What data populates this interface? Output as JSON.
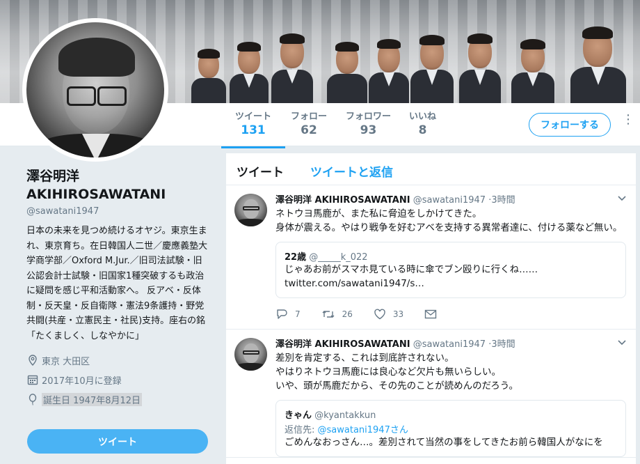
{
  "nav": {
    "stats": [
      {
        "label": "ツイート",
        "value": "131"
      },
      {
        "label": "フォロー",
        "value": "62"
      },
      {
        "label": "フォロワー",
        "value": "93"
      },
      {
        "label": "いいね",
        "value": "8"
      }
    ],
    "follow_label": "フォローする",
    "more": "⋮"
  },
  "profile": {
    "name_line1": "澤谷明洋",
    "name_line2": "AKIHIROSAWATANI",
    "handle": "@sawatani1947",
    "bio": "日本の未来を見つめ続けるオヤジ。東京生まれ、東京育ち。在日韓国人二世／慶應義塾大学商学部／Oxford M.Jur.／旧司法試験・旧公認会計士試験・旧国家1種突破するも政治に疑問を感じ平和活動家へ。 反アベ・反体制・反天皇・反自衛隊・憲法9条護持・野党共闘(共産・立憲民主・社民)支持。座右の銘「たくましく、しなやかに」",
    "location": "東京 大田区",
    "joined": "2017年10月に登録",
    "birthday": "誕生日 1947年8月12日",
    "tweet_button": "ツイート"
  },
  "timeline": {
    "tabs": [
      "ツイート",
      "ツイートと返信"
    ],
    "tweets": [
      {
        "name": "澤谷明洋 AKIHIROSAWATANI",
        "handle": "@sawatani1947",
        "time": "·3時間",
        "lines": [
          "ネトウヨ馬鹿が、また私に脅迫をしかけてきた。",
          "身体が震える。やはり戦争を好むアベを支持する異常者達に、付ける薬など無い。"
        ],
        "quote": {
          "name": "22歳",
          "handle": "@_____k_022",
          "text": "じゃあお前がスマホ見ている時に傘でブン殴りに行くね……",
          "link": "twitter.com/sawatani1947/s…"
        },
        "replies": "7",
        "retweets": "26",
        "likes": "33"
      },
      {
        "name": "澤谷明洋 AKIHIROSAWATANI",
        "handle": "@sawatani1947",
        "time": "·3時間",
        "lines": [
          "差別を肯定する、これは到底許されない。",
          "やはりネトウヨ馬鹿には良心など欠片も無いらしい。",
          "いや、頭が馬鹿だから、その先のことが読めんのだろう。"
        ],
        "quote": {
          "name": "きゃん",
          "handle": "@kyantakkun",
          "reply_prefix": "返信先: ",
          "reply_to": "@sawatani1947さん",
          "text": "ごめんなおっさん…。差別されて当然の事をしてきたお前ら韓国人がなにを"
        }
      }
    ]
  },
  "colors": {
    "accent": "#1da1f2",
    "tweet_button": "#4ab3f4",
    "background": "#e6ecf0"
  }
}
